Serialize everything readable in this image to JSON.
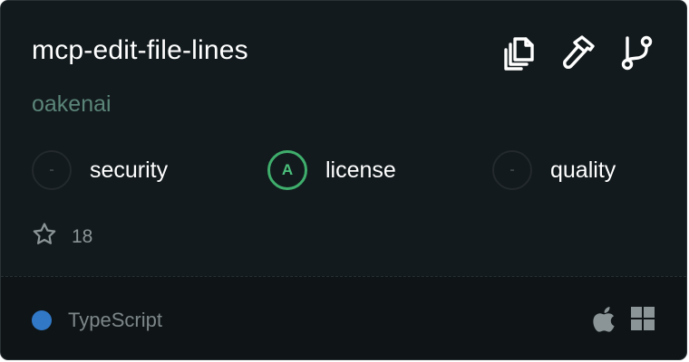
{
  "card": {
    "title": "mcp-edit-file-lines",
    "owner": "oakenai",
    "actions": [
      {
        "name": "copy",
        "icon": "copy-icon"
      },
      {
        "name": "tools",
        "icon": "hammer-icon"
      },
      {
        "name": "fork",
        "icon": "git-fork-icon"
      }
    ],
    "scores": [
      {
        "grade": "-",
        "label": "security"
      },
      {
        "grade": "A",
        "label": "license",
        "color": "#3fae6c"
      },
      {
        "grade": "-",
        "label": "quality"
      }
    ],
    "stars": {
      "icon": "star-icon",
      "count": "18"
    },
    "language": {
      "name": "TypeScript",
      "color": "#3178c6"
    },
    "platforms": [
      {
        "name": "apple",
        "icon": "apple-icon"
      },
      {
        "name": "windows",
        "icon": "windows-icon"
      }
    ]
  }
}
